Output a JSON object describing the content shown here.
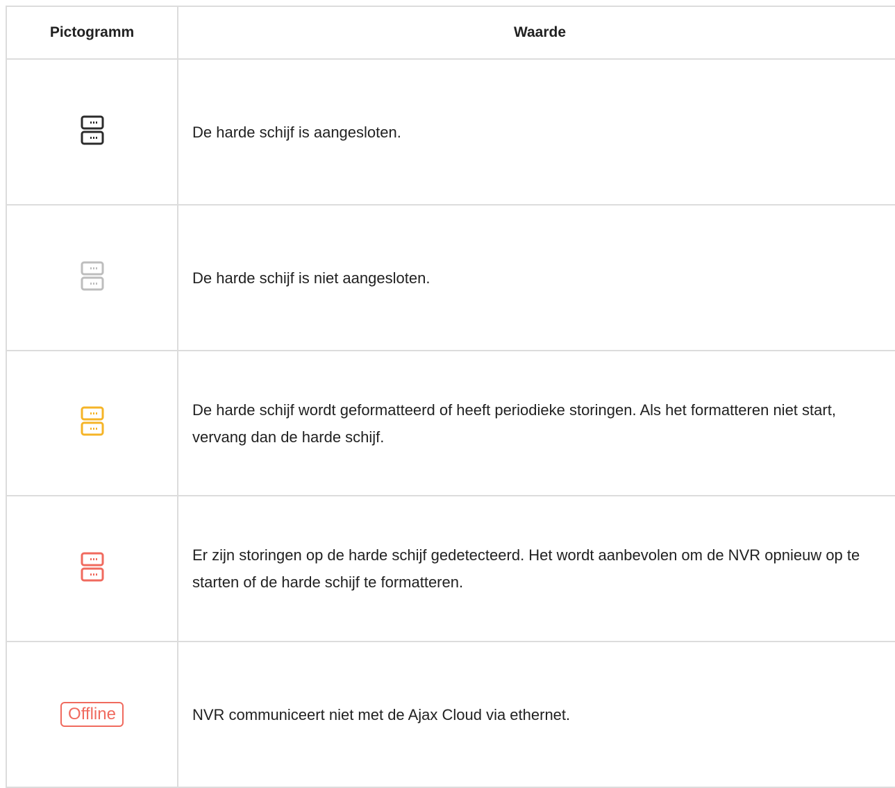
{
  "table": {
    "headers": {
      "icon": "Pictogramm",
      "value": "Waarde"
    },
    "rows": [
      {
        "icon": "hdd-connected-icon",
        "icon_color": "#2b2b2b",
        "text": "De harde schijf is aangesloten."
      },
      {
        "icon": "hdd-disconnected-icon",
        "icon_color": "#bdbdbd",
        "text": "De harde schijf is niet aangesloten."
      },
      {
        "icon": "hdd-formatting-icon",
        "icon_color": "#f5b427",
        "text": "De harde schijf wordt geformatteerd of heeft periodieke storingen. Als het formatteren niet start, vervang dan de harde schijf."
      },
      {
        "icon": "hdd-error-icon",
        "icon_color": "#f06a5e",
        "text": "Er zijn storingen op de harde schijf gedetecteerd. Het wordt aanbevolen om de NVR opnieuw op te starten of de harde schijf te formatteren."
      },
      {
        "icon": "offline-badge",
        "badge_label": "Offline",
        "icon_color": "#f06a5e",
        "text": "NVR communiceert niet met de Ajax Cloud via ethernet."
      }
    ]
  }
}
